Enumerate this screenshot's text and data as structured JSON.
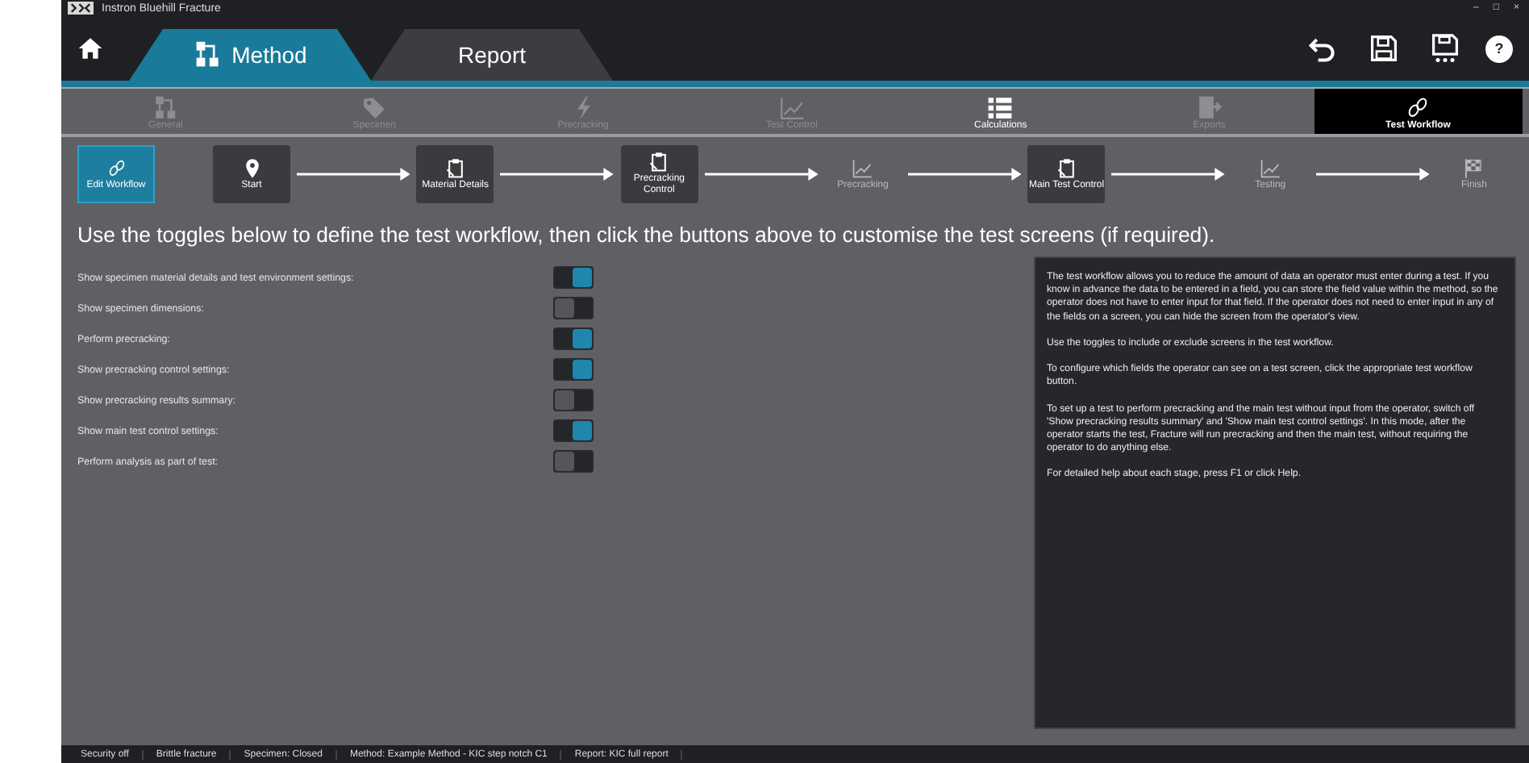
{
  "window": {
    "title": "Instron Bluehill Fracture",
    "controls": [
      "–",
      "□",
      "×"
    ]
  },
  "main_tabs": [
    {
      "label": "Method",
      "selected": true
    },
    {
      "label": "Report",
      "selected": false
    }
  ],
  "help_button": "?",
  "categories": [
    {
      "label": "General",
      "disabled": true,
      "selected": false
    },
    {
      "label": "Specimen",
      "disabled": true,
      "selected": false
    },
    {
      "label": "Precracking",
      "disabled": true,
      "selected": false
    },
    {
      "label": "Test Control",
      "disabled": true,
      "selected": false
    },
    {
      "label": "Calculations",
      "disabled": false,
      "selected": false
    },
    {
      "label": "Exports",
      "disabled": true,
      "selected": false
    },
    {
      "label": "Test Workflow",
      "disabled": false,
      "selected": true
    }
  ],
  "workflow": [
    {
      "label": "Edit Workflow",
      "kind": "edit",
      "selected": true
    },
    {
      "label": "Start",
      "kind": "button",
      "selected": false
    },
    {
      "label": "Material Details",
      "kind": "button",
      "selected": false
    },
    {
      "label": "Precracking Control",
      "kind": "button",
      "selected": false
    },
    {
      "label": "Precracking",
      "kind": "plain",
      "selected": false
    },
    {
      "label": "Main Test Control",
      "kind": "button",
      "selected": false
    },
    {
      "label": "Testing",
      "kind": "plain",
      "selected": false
    },
    {
      "label": "Finish",
      "kind": "plain",
      "selected": false
    }
  ],
  "instruction": "Use the toggles below to define the test workflow, then click the buttons above to customise the test screens (if required).",
  "toggles": [
    {
      "label": "Show specimen material details and test environment settings:",
      "on": true
    },
    {
      "label": "Show specimen dimensions:",
      "on": false
    },
    {
      "label": "Perform precracking:",
      "on": true
    },
    {
      "label": "Show precracking control settings:",
      "on": true
    },
    {
      "label": "Show precracking results summary:",
      "on": false
    },
    {
      "label": "Show main test control settings:",
      "on": true
    },
    {
      "label": "Perform analysis as part of test:",
      "on": false
    }
  ],
  "help_paragraphs": [
    "The test workflow allows you to reduce the amount of data an operator must enter during a test. If you know in advance the data to be entered in a field, you can store the field value within the method, so the operator does not have to enter input for that field. If the operator does not need to enter input in any of the fields on a screen, you can hide the screen from the operator's view.",
    "Use the toggles to include or exclude screens in the test workflow.",
    "To configure which fields the operator can see on a test screen, click the appropriate test workflow button.",
    "To set up a test to perform precracking and the main test without input from the operator, switch off 'Show precracking results summary' and 'Show main test control settings'. In this mode, after the operator starts the test, Fracture will run precracking and then the main test, without requiring the operator to do anything else.",
    "For detailed help about each stage, press F1 or click Help."
  ],
  "status_bar": [
    "Security off",
    "Brittle fracture",
    "Specimen: Closed",
    "Method: Example Method - KIC step notch C1",
    "Report: KIC full report"
  ]
}
